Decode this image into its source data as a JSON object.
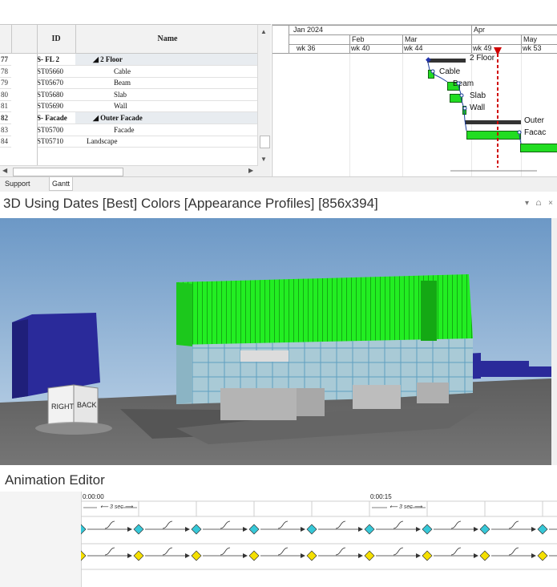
{
  "task_grid": {
    "headers": {
      "id": "ID",
      "name": "Name"
    },
    "rows": [
      {
        "num": "77",
        "id": "S- FL 2",
        "name": "◢ 2 Floor",
        "summary": true,
        "indent": 0
      },
      {
        "num": "78",
        "id": "ST05660",
        "name": "Cable",
        "summary": false,
        "indent": 2
      },
      {
        "num": "79",
        "id": "ST05670",
        "name": "Beam",
        "summary": false,
        "indent": 2
      },
      {
        "num": "80",
        "id": "ST05680",
        "name": "Slab",
        "summary": false,
        "indent": 2
      },
      {
        "num": "81",
        "id": "ST05690",
        "name": "Wall",
        "summary": false,
        "indent": 2
      },
      {
        "num": "82",
        "id": "S- Facade",
        "name": "◢ Outer Facade",
        "summary": true,
        "indent": 0
      },
      {
        "num": "83",
        "id": "ST05700",
        "name": "Facade",
        "summary": false,
        "indent": 2
      },
      {
        "num": "84",
        "id": "ST05710",
        "name": "Landscape",
        "summary": false,
        "indent": 0
      }
    ]
  },
  "gantt": {
    "years": [
      "Jan 2024"
    ],
    "months": [
      "Feb",
      "Mar",
      "Apr",
      "May"
    ],
    "weeks": [
      "wk 36",
      "wk 40",
      "wk 44",
      "wk 49",
      "wk 53"
    ],
    "labels": [
      "2 Floor",
      "Cable",
      "Beam",
      "Slab",
      "Wall",
      "Outer",
      "Facac"
    ]
  },
  "tabs": [
    {
      "label": "Support"
    },
    {
      "label": "Gantt"
    }
  ],
  "view": {
    "title": "3D Using Dates [Best] Colors [Appearance Profiles]  [856x394]",
    "controls": "▾ ⩍ ×",
    "cube_right": "RIGHT",
    "cube_back": "BACK"
  },
  "animation": {
    "title": "Animation Editor",
    "time_start": "0:00:00",
    "time_mid": "0:00:15",
    "interval": "3 sec",
    "colors": {
      "track1": "#36c8d8",
      "track2": "#f5e000"
    }
  },
  "colors": {
    "bar": "#22dd22",
    "summary_bar": "#333333",
    "today_line": "#d00000",
    "building_green": "#22ee22",
    "building_blue": "#2a2a9a"
  }
}
